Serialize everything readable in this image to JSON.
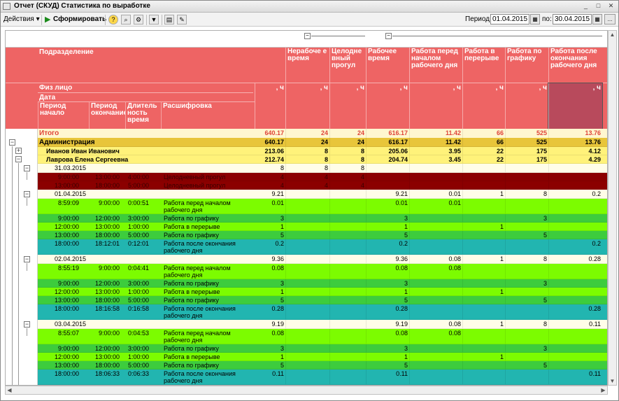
{
  "window": {
    "title": "Отчет  (СКУД) Статистика по выработке"
  },
  "toolbar": {
    "actions_label": "Действия ▾",
    "generate_label": "Сформировать",
    "period_label": "Период:",
    "to_label": "по:",
    "date_from": "01.04.2015",
    "date_to": "30.04.2015",
    "more_label": "..."
  },
  "header": {
    "col_dept": "Подразделение",
    "col_person": "Физ лицо",
    "col_date": "Дата",
    "col_start": "Период начало",
    "col_end": "Период окончание",
    "col_duration": "Длитель ность время",
    "col_detail": "Расшифровка",
    "cols": [
      "Нерабоче е время",
      "Целодне вный прогул",
      "Рабочее время",
      "Работа перед началом рабочего дня",
      "Работа в перерыве",
      "Работа по графику",
      "Работа после окончания рабочего дня"
    ],
    "unit": ", ч"
  },
  "total": {
    "label": "Итого",
    "total": "640.17",
    "vals": [
      "24",
      "24",
      "616.17",
      "11.42",
      "66",
      "525",
      "13.76"
    ]
  },
  "rows": [
    {
      "type": "dept",
      "label": "Администрация",
      "total": "640.17",
      "vals": [
        "24",
        "24",
        "616.17",
        "11.42",
        "66",
        "525",
        "13.76"
      ]
    },
    {
      "type": "person",
      "label": "Иванов Иван Иванович",
      "total": "213.06",
      "vals": [
        "8",
        "8",
        "205.06",
        "3.95",
        "22",
        "175",
        "4.12"
      ]
    },
    {
      "type": "person",
      "label": "Лаврова Елена Сергеевна",
      "total": "212.74",
      "vals": [
        "8",
        "8",
        "204.74",
        "3.45",
        "22",
        "175",
        "4.29"
      ]
    },
    {
      "type": "date",
      "label": "31.03.2015",
      "total": "8",
      "vals": [
        "8",
        "8",
        "",
        "",
        "",
        "",
        ""
      ]
    },
    {
      "type": "absent",
      "start": "9:00:00",
      "end": "13:00:00",
      "dur": "4:00:00",
      "detail": "Целодневный прогул",
      "total": "4",
      "vals": [
        "4",
        "4",
        "",
        "",
        "",
        "",
        ""
      ]
    },
    {
      "type": "absent",
      "start": "13:00:00",
      "end": "18:00:00",
      "dur": "5:00:00",
      "detail": "Целодневный прогул",
      "total": "4",
      "vals": [
        "4",
        "4",
        "",
        "",
        "",
        "",
        ""
      ]
    },
    {
      "type": "date",
      "label": "01.04.2015",
      "total": "9.21",
      "vals": [
        "",
        "",
        "9.21",
        "0.01",
        "1",
        "8",
        "0.2"
      ]
    },
    {
      "type": "detail",
      "color": "lime",
      "h": 2,
      "start": "8:59:09",
      "end": "9:00:00",
      "dur": "0:00:51",
      "detail": "Работа перед началом рабочего дня",
      "total": "0.01",
      "vals": [
        "",
        "",
        "0.01",
        "0.01",
        "",
        "",
        ""
      ]
    },
    {
      "type": "detail",
      "color": "green",
      "start": "9:00:00",
      "end": "12:00:00",
      "dur": "3:00:00",
      "detail": "Работа по графику",
      "total": "3",
      "vals": [
        "",
        "",
        "3",
        "",
        "",
        "3",
        ""
      ]
    },
    {
      "type": "detail",
      "color": "lime",
      "start": "12:00:00",
      "end": "13:00:00",
      "dur": "1:00:00",
      "detail": "Работа в перерыве",
      "total": "1",
      "vals": [
        "",
        "",
        "1",
        "",
        "1",
        "",
        ""
      ]
    },
    {
      "type": "detail",
      "color": "green",
      "start": "13:00:00",
      "end": "18:00:00",
      "dur": "5:00:00",
      "detail": "Работа по графику",
      "total": "5",
      "vals": [
        "",
        "",
        "5",
        "",
        "",
        "5",
        ""
      ]
    },
    {
      "type": "detail",
      "color": "teal",
      "h": 2,
      "start": "18:00:00",
      "end": "18:12:01",
      "dur": "0:12:01",
      "detail": "Работа после окончания рабочего дня",
      "total": "0.2",
      "vals": [
        "",
        "",
        "0.2",
        "",
        "",
        "",
        "0.2"
      ]
    },
    {
      "type": "date",
      "label": "02.04.2015",
      "total": "9.36",
      "vals": [
        "",
        "",
        "9.36",
        "0.08",
        "1",
        "8",
        "0.28"
      ]
    },
    {
      "type": "detail",
      "color": "lime",
      "h": 2,
      "start": "8:55:19",
      "end": "9:00:00",
      "dur": "0:04:41",
      "detail": "Работа перед началом рабочего дня",
      "total": "0.08",
      "vals": [
        "",
        "",
        "0.08",
        "0.08",
        "",
        "",
        ""
      ]
    },
    {
      "type": "detail",
      "color": "green",
      "start": "9:00:00",
      "end": "12:00:00",
      "dur": "3:00:00",
      "detail": "Работа по графику",
      "total": "3",
      "vals": [
        "",
        "",
        "3",
        "",
        "",
        "3",
        ""
      ]
    },
    {
      "type": "detail",
      "color": "lime",
      "start": "12:00:00",
      "end": "13:00:00",
      "dur": "1:00:00",
      "detail": "Работа в перерыве",
      "total": "1",
      "vals": [
        "",
        "",
        "1",
        "",
        "1",
        "",
        ""
      ]
    },
    {
      "type": "detail",
      "color": "green",
      "start": "13:00:00",
      "end": "18:00:00",
      "dur": "5:00:00",
      "detail": "Работа по графику",
      "total": "5",
      "vals": [
        "",
        "",
        "5",
        "",
        "",
        "5",
        ""
      ]
    },
    {
      "type": "detail",
      "color": "teal",
      "h": 2,
      "start": "18:00:00",
      "end": "18:16:58",
      "dur": "0:16:58",
      "detail": "Работа после окончания рабочего дня",
      "total": "0.28",
      "vals": [
        "",
        "",
        "0.28",
        "",
        "",
        "",
        "0.28"
      ]
    },
    {
      "type": "date",
      "label": "03.04.2015",
      "total": "9.19",
      "vals": [
        "",
        "",
        "9.19",
        "0.08",
        "1",
        "8",
        "0.11"
      ]
    },
    {
      "type": "detail",
      "color": "lime",
      "h": 2,
      "start": "8:55:07",
      "end": "9:00:00",
      "dur": "0:04:53",
      "detail": "Работа перед началом рабочего дня",
      "total": "0.08",
      "vals": [
        "",
        "",
        "0.08",
        "0.08",
        "",
        "",
        ""
      ]
    },
    {
      "type": "detail",
      "color": "green",
      "start": "9:00:00",
      "end": "12:00:00",
      "dur": "3:00:00",
      "detail": "Работа по графику",
      "total": "3",
      "vals": [
        "",
        "",
        "3",
        "",
        "",
        "3",
        ""
      ]
    },
    {
      "type": "detail",
      "color": "lime",
      "start": "12:00:00",
      "end": "13:00:00",
      "dur": "1:00:00",
      "detail": "Работа в перерыве",
      "total": "1",
      "vals": [
        "",
        "",
        "1",
        "",
        "1",
        "",
        ""
      ]
    },
    {
      "type": "detail",
      "color": "green",
      "start": "13:00:00",
      "end": "18:00:00",
      "dur": "5:00:00",
      "detail": "Работа по графику",
      "total": "5",
      "vals": [
        "",
        "",
        "5",
        "",
        "",
        "5",
        ""
      ]
    },
    {
      "type": "detail",
      "color": "teal",
      "h": 2,
      "start": "18:00:00",
      "end": "18:06:33",
      "dur": "0:06:33",
      "detail": "Работа после окончания рабочего дня",
      "total": "0.11",
      "vals": [
        "",
        "",
        "0.11",
        "",
        "",
        "",
        "0.11"
      ]
    }
  ],
  "colors": {
    "header": "#ee6464",
    "total_bg": "#fff7d0",
    "total_fg": "#e0443a",
    "dept": "#e8c53a",
    "person": "#fff27a",
    "date": "#fffde8",
    "absent": "#8b0000",
    "lime": "#7cfc00",
    "green": "#3dcc3d",
    "teal": "#22b5b0"
  }
}
